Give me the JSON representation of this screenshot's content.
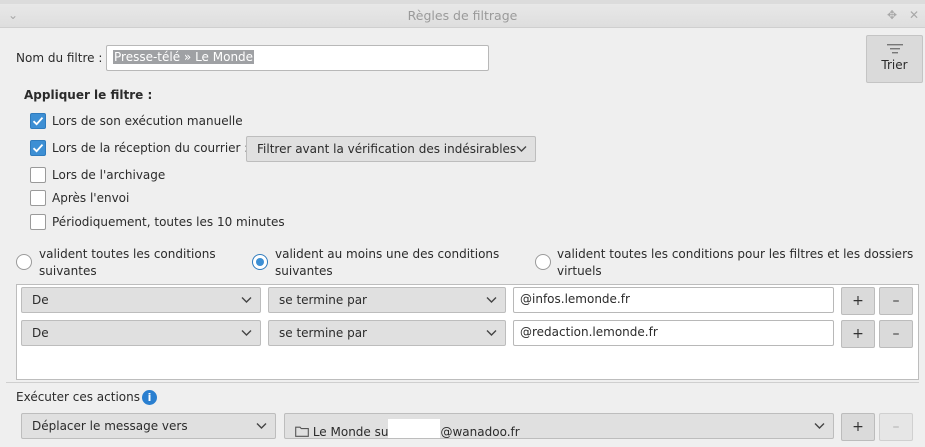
{
  "window": {
    "title": "Règles de filtrage"
  },
  "filter_name": {
    "label": "Nom du filtre :",
    "value": "Presse-télé » Le Monde"
  },
  "sort_button": {
    "label": "Trier",
    "icon": "sort-lines-icon"
  },
  "apply": {
    "heading": "Appliquer le filtre :",
    "options": [
      {
        "label": "Lors de son exécution manuelle",
        "checked": true
      },
      {
        "label": "Lors de la réception du courrier :",
        "checked": true
      },
      {
        "label": "Lors de l'archivage",
        "checked": false
      },
      {
        "label": "Après l'envoi",
        "checked": false
      },
      {
        "label": "Périodiquement, toutes les 10 minutes",
        "checked": false
      }
    ],
    "reception_mode": "Filtrer avant la vérification des indésirables"
  },
  "match": {
    "all_line1": "valident toutes les conditions",
    "all_line2": "suivantes",
    "any_line1": "valident au moins une des conditions",
    "any_line2": "suivantes",
    "virtual_line1": "valident toutes les conditions pour les filtres et les dossiers",
    "virtual_line2": "virtuels",
    "selected": "any"
  },
  "conditions": [
    {
      "field": "De",
      "operator": "se termine par",
      "value": "@infos.lemonde.fr",
      "add": "+",
      "remove": "–"
    },
    {
      "field": "De",
      "operator": "se termine par",
      "value": "@redaction.lemonde.fr",
      "add": "+",
      "remove": "–"
    }
  ],
  "actions": {
    "label": "Exécuter ces actions :",
    "info_icon": "info-icon",
    "rows": [
      {
        "action": "Déplacer le message vers",
        "folder_prefix": "Le Monde su",
        "folder_suffix": "@wanadoo.fr",
        "add": "+",
        "remove": "–"
      }
    ]
  },
  "colors": {
    "accent": "#3d8fd4",
    "info": "#2a7fd0",
    "selection": "#9fa1a4"
  }
}
